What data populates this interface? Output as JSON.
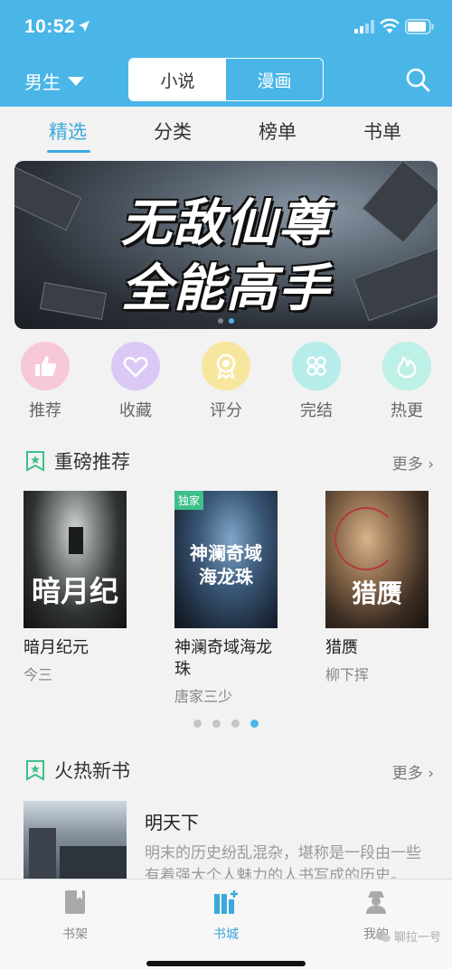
{
  "status_bar": {
    "time": "10:52"
  },
  "header": {
    "gender_label": "男生",
    "segments": [
      {
        "label": "小说",
        "active": true
      },
      {
        "label": "漫画",
        "active": false
      }
    ]
  },
  "subtabs": [
    {
      "label": "精选",
      "active": true
    },
    {
      "label": "分类",
      "active": false
    },
    {
      "label": "榜单",
      "active": false
    },
    {
      "label": "书单",
      "active": false
    }
  ],
  "banner": {
    "line1": "无敌仙尊",
    "line2": "全能高手",
    "page_count": 2,
    "current_page": 2
  },
  "quick_links": [
    {
      "label": "推荐",
      "icon": "thumbs-up-icon",
      "color": "#f08fae",
      "bg": "#f7c9d8"
    },
    {
      "label": "收藏",
      "icon": "heart-icon",
      "color": "#a98be6",
      "bg": "#d9c9f4"
    },
    {
      "label": "评分",
      "icon": "award-icon",
      "color": "#f2cf4a",
      "bg": "#f7e79e"
    },
    {
      "label": "完结",
      "icon": "grid-icon",
      "color": "#57c9c6",
      "bg": "#b6ecea"
    },
    {
      "label": "热更",
      "icon": "flame-icon",
      "color": "#62d2c0",
      "bg": "#bdf0e6"
    }
  ],
  "featured": {
    "title": "重磅推荐",
    "more": "更多",
    "books": [
      {
        "title": "暗月纪元",
        "author": "今三",
        "cover_text": "暗月纪",
        "exclusive": ""
      },
      {
        "title": "神澜奇域海龙珠",
        "author": "唐家三少",
        "cover_text": "神澜奇域海龙珠",
        "exclusive": "独家"
      },
      {
        "title": "猎赝",
        "author": "柳下挥",
        "cover_text": "猎赝",
        "exclusive": ""
      }
    ],
    "page_count": 4,
    "current_page": 4
  },
  "hot_new": {
    "title": "火热新书",
    "more": "更多",
    "book": {
      "title": "明天下",
      "description": "明末的历史纷乱混杂，堪称是一段由一些有着强大个人魅力的人书写成的历史。..."
    }
  },
  "tabbar": [
    {
      "label": "书架",
      "icon": "bookshelf-icon",
      "active": false
    },
    {
      "label": "书城",
      "icon": "bookstore-icon",
      "active": true
    },
    {
      "label": "我的",
      "icon": "profile-icon",
      "active": false
    }
  ],
  "watermark": "聊拉一号",
  "colors": {
    "primary": "#4ab6e8",
    "accent": "#3aa9dc",
    "exclusive": "#3dbf8a"
  }
}
